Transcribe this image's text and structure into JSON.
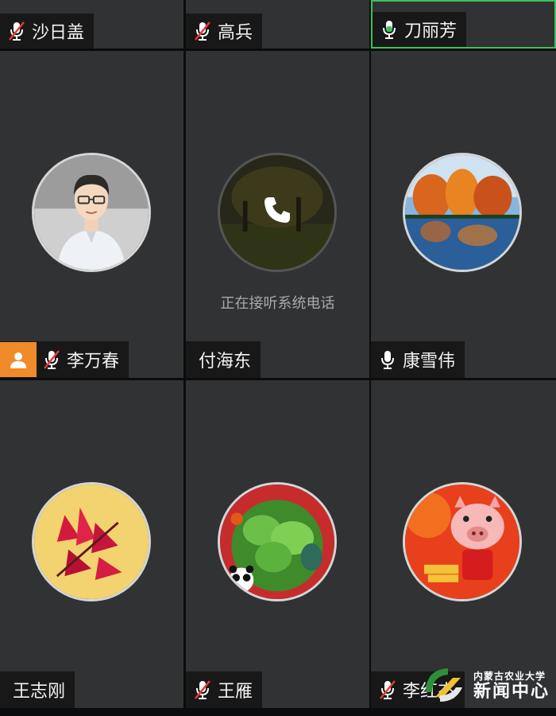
{
  "participants": [
    {
      "name": "沙日盖",
      "mic": "muted"
    },
    {
      "name": "高兵",
      "mic": "muted"
    },
    {
      "name": "刀丽芳",
      "mic": "speaking"
    },
    {
      "name": "李万春",
      "mic": "muted",
      "host": true
    },
    {
      "name": "付海东",
      "mic": "none",
      "status": "正在接听系统电话"
    },
    {
      "name": "康雪伟",
      "mic": "on"
    },
    {
      "name": "王志刚",
      "mic": "none"
    },
    {
      "name": "王雁",
      "mic": "muted"
    },
    {
      "name": "李红杰",
      "mic": "muted"
    }
  ],
  "watermark": {
    "line1": "内蒙古农业大学",
    "line2": "新闻中心"
  },
  "colors": {
    "tile": "#303234",
    "active_border": "#3fbf5b",
    "host_badge": "#f08a2a",
    "muted_slash": "#e53935"
  }
}
